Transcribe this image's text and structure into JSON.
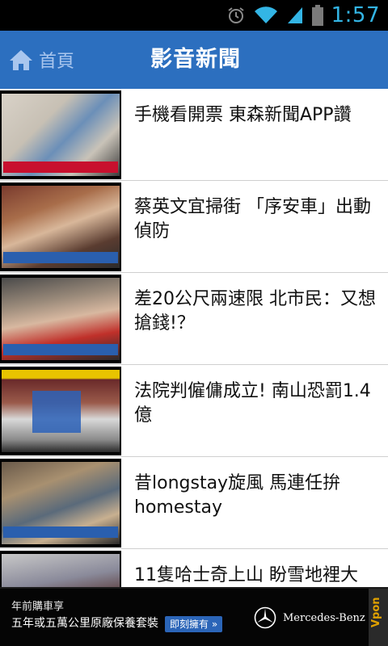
{
  "status_bar": {
    "time": "1:57"
  },
  "app_bar": {
    "home_label": "首頁",
    "title": "影音新聞"
  },
  "news_items": [
    {
      "title": "手機看開票 東森新聞APP讚"
    },
    {
      "title": "蔡英文宜掃街 「序安車」出動偵防"
    },
    {
      "title": "差20公尺兩速限 北市民：又想搶錢!？"
    },
    {
      "title": "法院判僱傭成立! 南山恐罰1.4億"
    },
    {
      "title": "昔longstay旋風 馬連任拚homestay"
    },
    {
      "title": "11隻哈士奇上山 盼雪地裡大"
    }
  ],
  "ad": {
    "line1": "年前購車享",
    "line2": "五年或五萬公里原廠保養套裝",
    "button": "即刻擁有 »",
    "brand": "Mercedes-Benz",
    "network": "Vpon"
  },
  "colors": {
    "app_bar": "#2c6fbf",
    "status_time": "#33b5e5",
    "ad_button": "#2b65b8"
  }
}
